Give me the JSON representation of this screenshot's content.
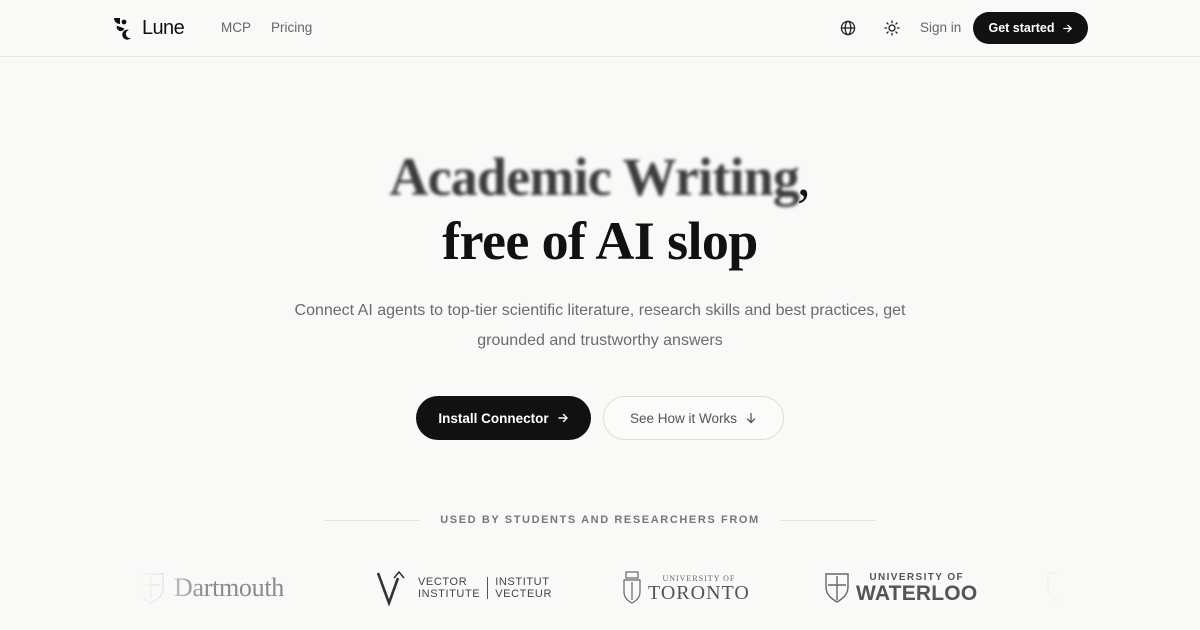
{
  "header": {
    "brand": "Lune",
    "nav": [
      {
        "label": "MCP"
      },
      {
        "label": "Pricing"
      }
    ],
    "language_icon": "globe-icon",
    "theme_icon": "sun-icon",
    "sign_in": "Sign in",
    "cta": "Get started"
  },
  "hero": {
    "headline_line1": "Academic Writing",
    "headline_comma": ",",
    "headline_line2": "free of AI slop",
    "subtitle": "Connect AI agents to top-tier scientific literature, research skills and best practices, get grounded and trustworthy answers",
    "primary_cta": "Install Connector",
    "secondary_cta": "See How it Works"
  },
  "social_proof": {
    "label": "USED BY STUDENTS AND RESEARCHERS FROM",
    "logos": {
      "dartmouth": "Dartmouth",
      "vector_left_1": "VECTOR",
      "vector_left_2": "INSTITUTE",
      "vector_right_1": "INSTITUT",
      "vector_right_2": "VECTEUR",
      "toronto_small": "UNIVERSITY OF",
      "toronto_big": "TORONTO",
      "waterloo_small": "UNIVERSITY OF",
      "waterloo_big": "WATERLOO"
    }
  },
  "colors": {
    "background": "#f9f9f8",
    "primary": "#111111",
    "muted_text": "#6b6b6b"
  }
}
